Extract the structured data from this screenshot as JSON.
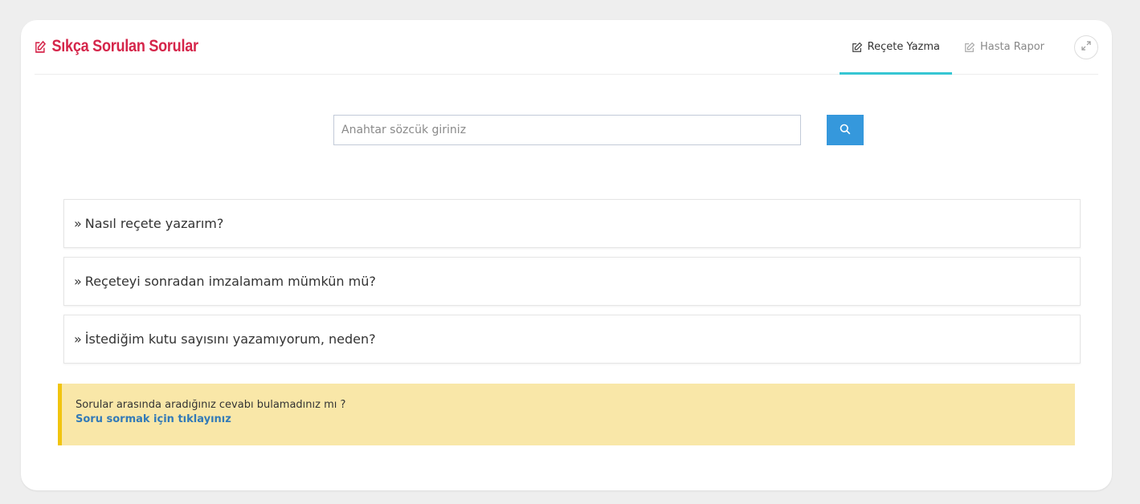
{
  "header": {
    "title": "Sıkça Sorulan Sorular",
    "title_icon": "edit-icon",
    "tabs": [
      {
        "label": "Reçete Yazma",
        "icon": "edit-icon",
        "active": true
      },
      {
        "label": "Hasta Rapor",
        "icon": "edit-icon",
        "active": false
      }
    ],
    "fullscreen_icon": "expand-icon"
  },
  "search": {
    "placeholder": "Anahtar sözcük giriniz",
    "value": "",
    "button_icon": "search-icon"
  },
  "faq": {
    "prefix": "»",
    "items": [
      {
        "question": "Nasıl reçete yazarım?"
      },
      {
        "question": "Reçeteyi sonradan imzalamam mümkün mü?"
      },
      {
        "question": "İstediğim kutu sayısını yazamıyorum, neden?"
      }
    ]
  },
  "notice": {
    "text": "Sorular arasında aradığınız cevabı bulamadınız mı ?",
    "link": "Soru sormak için tıklayınız"
  },
  "colors": {
    "title": "#d5254a",
    "active_tab_underline": "#36c6d3",
    "search_button": "#3598dc",
    "notice_bg": "#f9e7a8",
    "notice_border": "#f1c40f",
    "link": "#337ab7"
  }
}
